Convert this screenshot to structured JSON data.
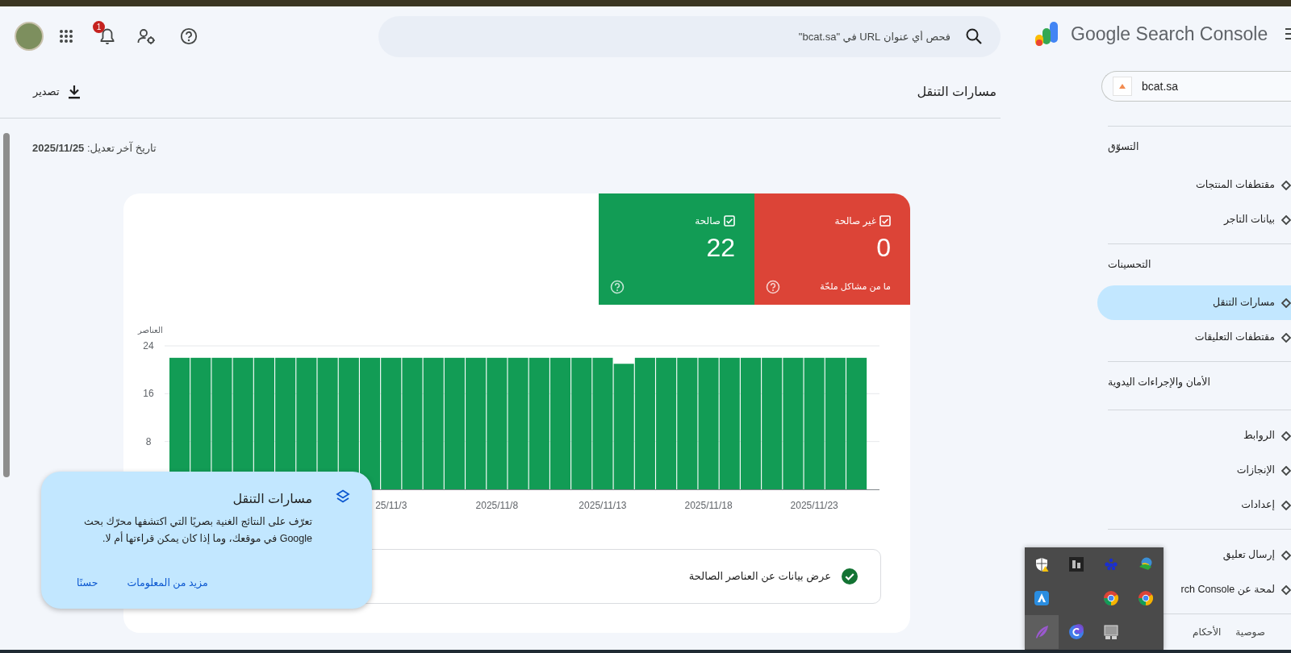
{
  "header": {
    "logo_text": "Google Search Console",
    "search": {
      "placeholder": "فحص أي عنوان URL في \"bcat.sa\""
    },
    "notification_count": "1"
  },
  "property": {
    "name": "bcat.sa"
  },
  "sidebar": {
    "sections": [
      {
        "title": "التسوّق",
        "items": [
          {
            "label": "مقتطفات المنتجات",
            "selected": false
          },
          {
            "label": "بيانات التاجر",
            "selected": false
          }
        ]
      },
      {
        "title": "التحسينات",
        "items": [
          {
            "label": "مسارات التنقل",
            "selected": true
          },
          {
            "label": "مقتطفات التعليقات",
            "selected": false
          }
        ]
      },
      {
        "title": "الأمان والإجراءات اليدوية"
      },
      {
        "items": [
          {
            "label": "الروابط",
            "selected": false
          },
          {
            "label": "الإنجازات",
            "selected": false
          },
          {
            "label": "إعدادات",
            "selected": false
          }
        ]
      },
      {
        "items": [
          {
            "label": "إرسال تعليق",
            "selected": false
          },
          {
            "label": "لمحة عن rch Console",
            "selected": false
          }
        ]
      }
    ],
    "footer_links": [
      "صوصية",
      "الأحكام"
    ]
  },
  "page": {
    "title": "مسارات التنقل",
    "export_label": "تصدير",
    "last_updated": "تاريخ آخر تعديل: **2025/11/25**"
  },
  "summary_tiles": [
    {
      "label": "غير صالحة",
      "checked": true,
      "count": "0",
      "note": "ما من مشاكل ملحّة",
      "color": "#dc4437"
    },
    {
      "label": "صالحة",
      "checked": true,
      "count": "22",
      "color": "#129c55"
    }
  ],
  "chart": {
    "chart_data": {
      "type": "bar",
      "ylabel": "العناصر",
      "categories": [
        null,
        null,
        null,
        null,
        null,
        null,
        null,
        null,
        null,
        null,
        "25/11/3",
        null,
        null,
        null,
        null,
        "2025/11/8",
        null,
        null,
        null,
        null,
        "2025/11/13",
        null,
        null,
        null,
        null,
        "2025/11/18",
        null,
        null,
        null,
        null,
        "2025/11/23",
        null,
        null
      ],
      "series": [
        {
          "color": "#129c55",
          "values": [
            22,
            22,
            22,
            22,
            22,
            22,
            22,
            22,
            22,
            22,
            22,
            22,
            22,
            22,
            22,
            22,
            22,
            22,
            22,
            22,
            22,
            21,
            22,
            22,
            22,
            22,
            22,
            22,
            22,
            22,
            22,
            22,
            22
          ]
        }
      ],
      "ylim": [
        0,
        24
      ],
      "yticks": [
        8,
        16,
        24
      ]
    }
  },
  "details_row": {
    "label": "عرض بيانات عن العناصر الصالحة"
  },
  "popup": {
    "title": "مسارات التنقل",
    "body": "تعرّف على النتائج الغنية بصريًا التي اكتشفها محرّك بحث Google في موقعك، وما إذا كان يمكن قراءتها أم لا.",
    "buttons": [
      "مزيد من المعلومات",
      "حسنًا"
    ]
  },
  "tray": {
    "rows": [
      [
        {
          "kind": "shield",
          "selected": false
        },
        {
          "kind": "dark-app",
          "selected": false
        },
        {
          "kind": "dots",
          "selected": false
        },
        {
          "kind": "globe",
          "selected": false
        }
      ],
      [
        {
          "kind": "blue-app",
          "selected": false
        },
        {
          "kind": "chrome",
          "selected": false
        },
        {
          "kind": "chrome",
          "selected": false
        }
      ],
      [
        {
          "kind": "feather",
          "selected": true
        },
        {
          "kind": "c-circle",
          "selected": false
        },
        {
          "kind": "monitor",
          "selected": false
        }
      ]
    ]
  }
}
